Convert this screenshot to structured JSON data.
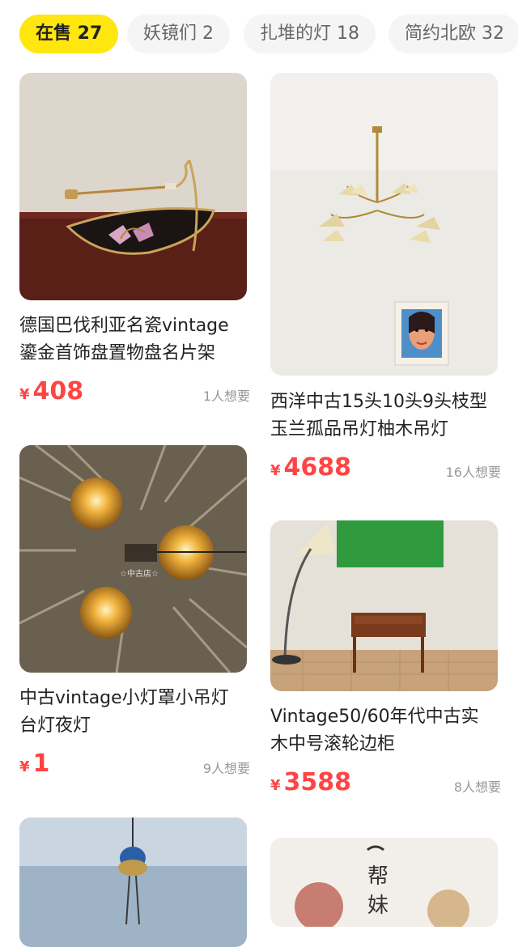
{
  "tabs": [
    {
      "label": "在售 27"
    },
    {
      "label": "妖镜们 2"
    },
    {
      "label": "扎堆的灯 18"
    },
    {
      "label": "简约北欧 32"
    }
  ],
  "products": [
    {
      "title": "德国巴伐利亚名瓷vintage\n鎏金首饰盘置物盘名片架",
      "currency": "¥",
      "price": "408",
      "wants": "1人想要"
    },
    {
      "title": "西洋中古15头10头9头枝型\n玉兰孤品吊灯柚木吊灯",
      "currency": "¥",
      "price": "4688",
      "wants": "16人想要"
    },
    {
      "title": "中古vintage小灯罩小吊灯\n台灯夜灯",
      "currency": "¥",
      "price": "1",
      "wants": "9人想要"
    },
    {
      "title": "Vintage50/60年代中古实\n木中号滚轮边柜",
      "currency": "¥",
      "price": "3588",
      "wants": "8人想要"
    }
  ],
  "watermarks": {
    "lamp_img": "☆中古店☆",
    "plate_img": "",
    "partial_img_text": "帮 妹"
  }
}
